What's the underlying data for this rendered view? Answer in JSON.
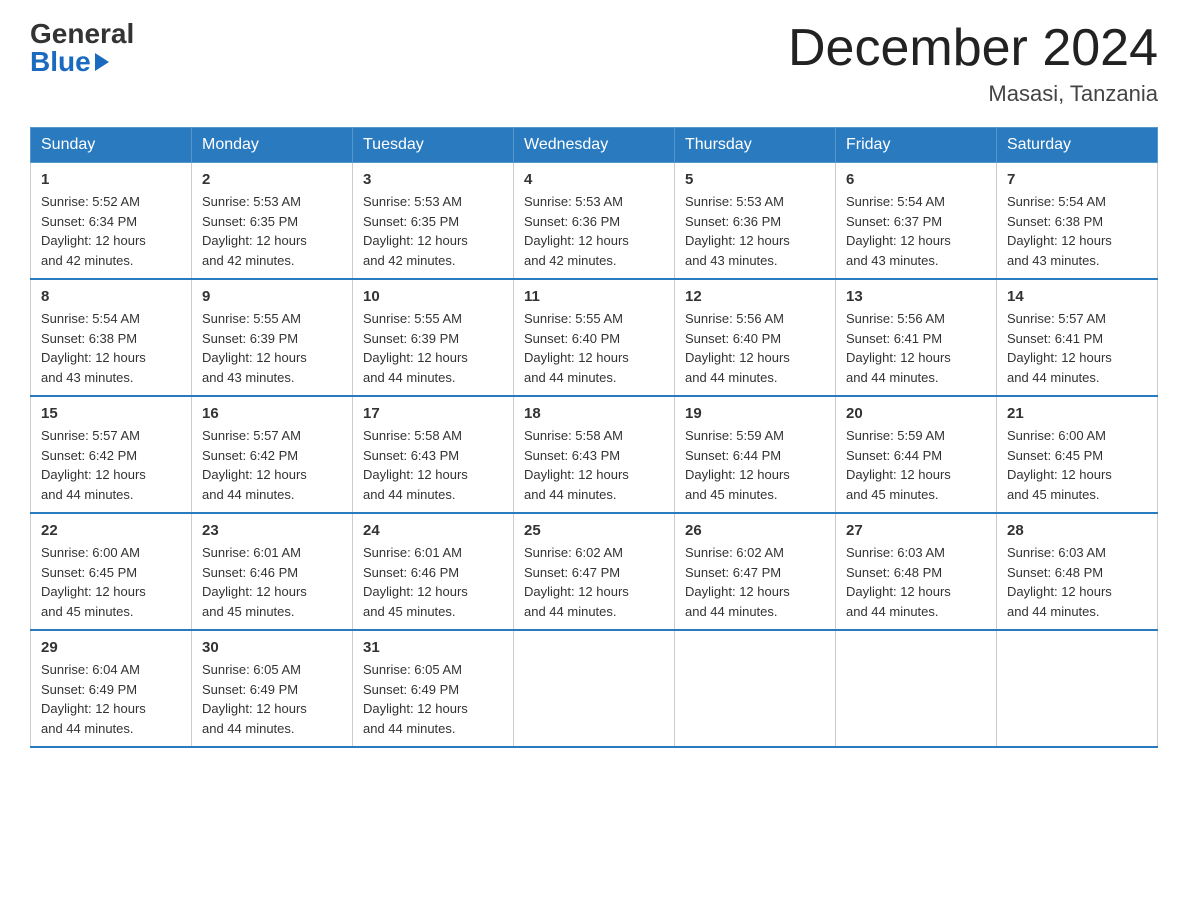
{
  "header": {
    "logo_general": "General",
    "logo_blue": "Blue",
    "month_title": "December 2024",
    "location": "Masasi, Tanzania"
  },
  "days_of_week": [
    "Sunday",
    "Monday",
    "Tuesday",
    "Wednesday",
    "Thursday",
    "Friday",
    "Saturday"
  ],
  "weeks": [
    {
      "days": [
        {
          "date": "1",
          "sunrise": "5:52 AM",
          "sunset": "6:34 PM",
          "daylight": "12 hours and 42 minutes."
        },
        {
          "date": "2",
          "sunrise": "5:53 AM",
          "sunset": "6:35 PM",
          "daylight": "12 hours and 42 minutes."
        },
        {
          "date": "3",
          "sunrise": "5:53 AM",
          "sunset": "6:35 PM",
          "daylight": "12 hours and 42 minutes."
        },
        {
          "date": "4",
          "sunrise": "5:53 AM",
          "sunset": "6:36 PM",
          "daylight": "12 hours and 42 minutes."
        },
        {
          "date": "5",
          "sunrise": "5:53 AM",
          "sunset": "6:36 PM",
          "daylight": "12 hours and 43 minutes."
        },
        {
          "date": "6",
          "sunrise": "5:54 AM",
          "sunset": "6:37 PM",
          "daylight": "12 hours and 43 minutes."
        },
        {
          "date": "7",
          "sunrise": "5:54 AM",
          "sunset": "6:38 PM",
          "daylight": "12 hours and 43 minutes."
        }
      ]
    },
    {
      "days": [
        {
          "date": "8",
          "sunrise": "5:54 AM",
          "sunset": "6:38 PM",
          "daylight": "12 hours and 43 minutes."
        },
        {
          "date": "9",
          "sunrise": "5:55 AM",
          "sunset": "6:39 PM",
          "daylight": "12 hours and 43 minutes."
        },
        {
          "date": "10",
          "sunrise": "5:55 AM",
          "sunset": "6:39 PM",
          "daylight": "12 hours and 44 minutes."
        },
        {
          "date": "11",
          "sunrise": "5:55 AM",
          "sunset": "6:40 PM",
          "daylight": "12 hours and 44 minutes."
        },
        {
          "date": "12",
          "sunrise": "5:56 AM",
          "sunset": "6:40 PM",
          "daylight": "12 hours and 44 minutes."
        },
        {
          "date": "13",
          "sunrise": "5:56 AM",
          "sunset": "6:41 PM",
          "daylight": "12 hours and 44 minutes."
        },
        {
          "date": "14",
          "sunrise": "5:57 AM",
          "sunset": "6:41 PM",
          "daylight": "12 hours and 44 minutes."
        }
      ]
    },
    {
      "days": [
        {
          "date": "15",
          "sunrise": "5:57 AM",
          "sunset": "6:42 PM",
          "daylight": "12 hours and 44 minutes."
        },
        {
          "date": "16",
          "sunrise": "5:57 AM",
          "sunset": "6:42 PM",
          "daylight": "12 hours and 44 minutes."
        },
        {
          "date": "17",
          "sunrise": "5:58 AM",
          "sunset": "6:43 PM",
          "daylight": "12 hours and 44 minutes."
        },
        {
          "date": "18",
          "sunrise": "5:58 AM",
          "sunset": "6:43 PM",
          "daylight": "12 hours and 44 minutes."
        },
        {
          "date": "19",
          "sunrise": "5:59 AM",
          "sunset": "6:44 PM",
          "daylight": "12 hours and 45 minutes."
        },
        {
          "date": "20",
          "sunrise": "5:59 AM",
          "sunset": "6:44 PM",
          "daylight": "12 hours and 45 minutes."
        },
        {
          "date": "21",
          "sunrise": "6:00 AM",
          "sunset": "6:45 PM",
          "daylight": "12 hours and 45 minutes."
        }
      ]
    },
    {
      "days": [
        {
          "date": "22",
          "sunrise": "6:00 AM",
          "sunset": "6:45 PM",
          "daylight": "12 hours and 45 minutes."
        },
        {
          "date": "23",
          "sunrise": "6:01 AM",
          "sunset": "6:46 PM",
          "daylight": "12 hours and 45 minutes."
        },
        {
          "date": "24",
          "sunrise": "6:01 AM",
          "sunset": "6:46 PM",
          "daylight": "12 hours and 45 minutes."
        },
        {
          "date": "25",
          "sunrise": "6:02 AM",
          "sunset": "6:47 PM",
          "daylight": "12 hours and 44 minutes."
        },
        {
          "date": "26",
          "sunrise": "6:02 AM",
          "sunset": "6:47 PM",
          "daylight": "12 hours and 44 minutes."
        },
        {
          "date": "27",
          "sunrise": "6:03 AM",
          "sunset": "6:48 PM",
          "daylight": "12 hours and 44 minutes."
        },
        {
          "date": "28",
          "sunrise": "6:03 AM",
          "sunset": "6:48 PM",
          "daylight": "12 hours and 44 minutes."
        }
      ]
    },
    {
      "days": [
        {
          "date": "29",
          "sunrise": "6:04 AM",
          "sunset": "6:49 PM",
          "daylight": "12 hours and 44 minutes."
        },
        {
          "date": "30",
          "sunrise": "6:05 AM",
          "sunset": "6:49 PM",
          "daylight": "12 hours and 44 minutes."
        },
        {
          "date": "31",
          "sunrise": "6:05 AM",
          "sunset": "6:49 PM",
          "daylight": "12 hours and 44 minutes."
        },
        null,
        null,
        null,
        null
      ]
    }
  ],
  "labels": {
    "sunrise": "Sunrise:",
    "sunset": "Sunset:",
    "daylight": "Daylight:"
  }
}
